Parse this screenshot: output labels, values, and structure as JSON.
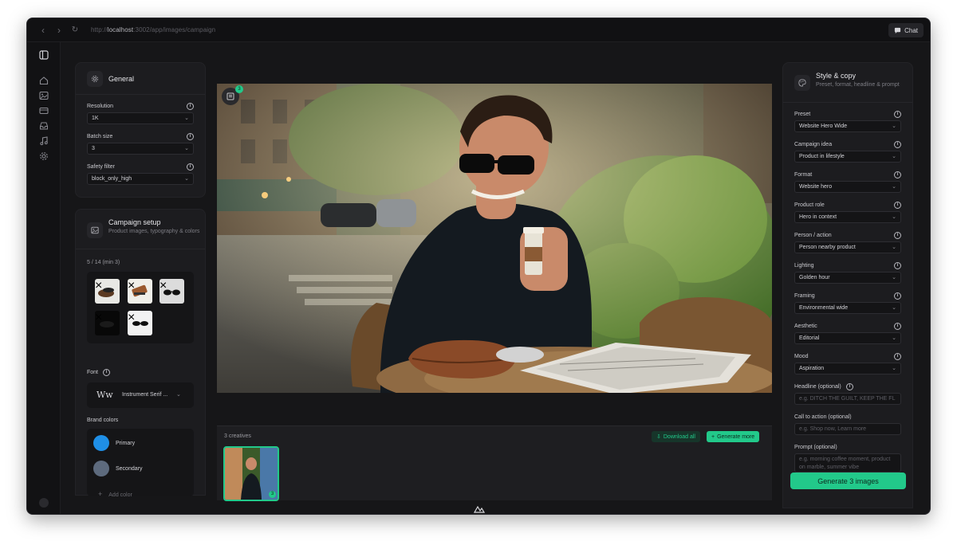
{
  "browser": {
    "url_prefix": "http://",
    "url_host": "localhost",
    "url_rest": ":3002/app/images/campaign",
    "chat_label": "Chat"
  },
  "general": {
    "title": "General",
    "resolution_label": "Resolution",
    "resolution_value": "1K",
    "batch_label": "Batch size",
    "batch_value": "3",
    "safety_label": "Safety filter",
    "safety_value": "block_only_high"
  },
  "campaign": {
    "title": "Campaign setup",
    "subtitle": "Product images, typography & colors",
    "count": "5 / 14 (min 3)",
    "font_label": "Font",
    "font_preview": "Ww",
    "font_value": "Instrument Serif ...",
    "brand_colors_label": "Brand colors",
    "colors": [
      {
        "name": "Primary",
        "hex": "#1f8fe6"
      },
      {
        "name": "Secondary",
        "hex": "#5d6a7d"
      }
    ],
    "add_color": "Add color"
  },
  "canvas": {
    "badge_count": "3"
  },
  "gallery": {
    "count_label": "3 creatives",
    "download_all": "Download all",
    "generate_more": "Generate more",
    "thumb_badge": "3"
  },
  "style": {
    "title": "Style & copy",
    "subtitle": "Preset, format, headline & prompt",
    "fields": [
      {
        "label": "Preset",
        "value": "Website Hero Wide"
      },
      {
        "label": "Campaign idea",
        "value": "Product in lifestyle"
      },
      {
        "label": "Format",
        "value": "Website hero"
      },
      {
        "label": "Product role",
        "value": "Hero in context"
      },
      {
        "label": "Person / action",
        "value": "Person nearby product"
      },
      {
        "label": "Lighting",
        "value": "Golden hour"
      },
      {
        "label": "Framing",
        "value": "Environmental wide"
      },
      {
        "label": "Aesthetic",
        "value": "Editorial"
      },
      {
        "label": "Mood",
        "value": "Aspiration"
      }
    ],
    "headline_label": "Headline (optional)",
    "headline_placeholder": "e.g. DITCH THE GUILT, KEEP THE FL",
    "cta_label": "Call to action (optional)",
    "cta_placeholder": "e.g. Shop now, Learn more",
    "prompt_label": "Prompt (optional)",
    "prompt_placeholder": "e.g. morning coffee moment, product on marble, summer vibe",
    "generate_label": "Generate 3 images"
  },
  "colors": {
    "accent": "#22c98a",
    "frame_bg": "#161618",
    "card_bg": "#1c1c1f"
  }
}
